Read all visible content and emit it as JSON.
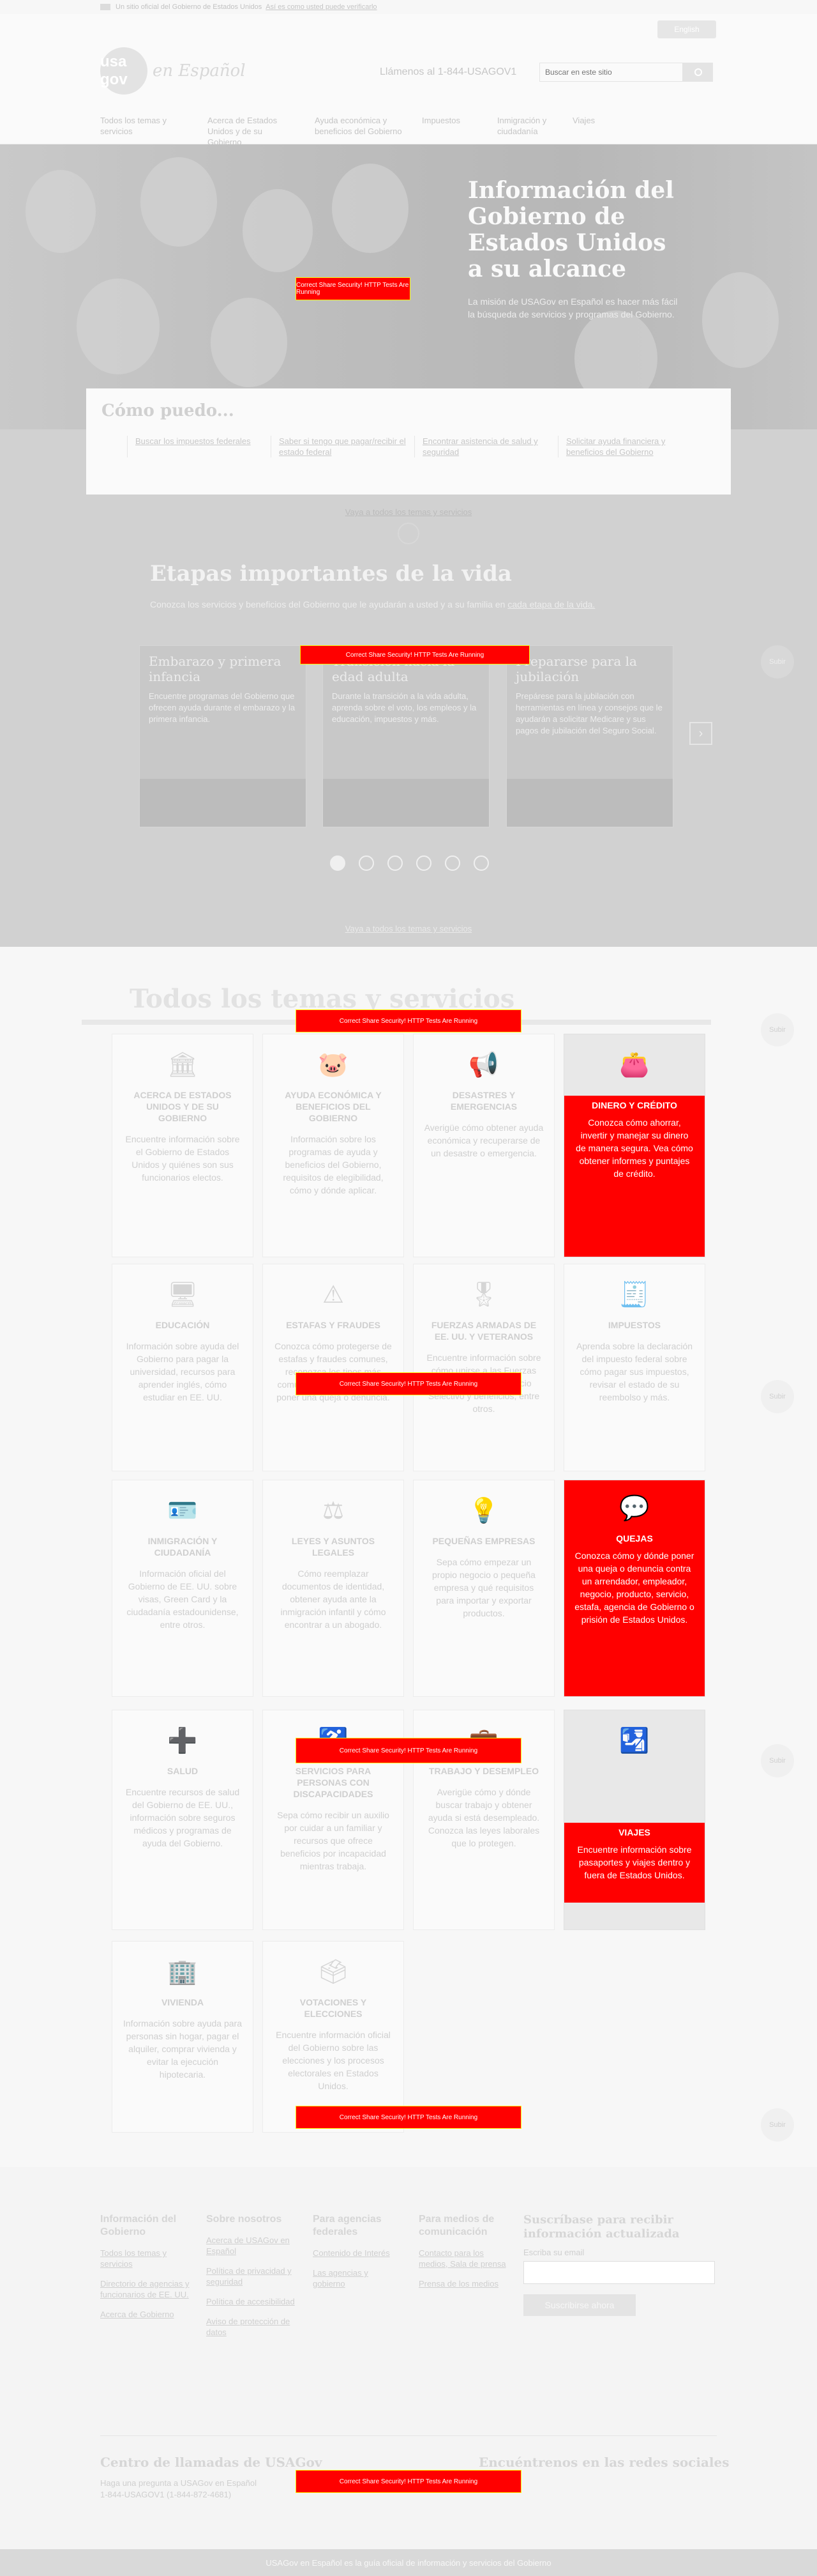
{
  "banner": {
    "text": "Un sitio oficial del Gobierno de Estados Unidos",
    "link": "Así es como usted puede verificarlo"
  },
  "header": {
    "lang_button": "English",
    "logo_mark": "usa gov",
    "logo_tagline": "en Español",
    "phone": "Llámenos al 1-844-USAGOV1",
    "search_placeholder": "Buscar en este sitio"
  },
  "nav": [
    "Todos los temas y servicios",
    "Acerca de Estados Unidos y de su Gobierno",
    "Ayuda económica y beneficios del Gobierno",
    "Impuestos",
    "Inmigración y ciudadanía",
    "Viajes"
  ],
  "hero": {
    "title": "Información del Gobierno de Estados Unidos a su alcance",
    "subtitle": "La misión de USAGov en Español es hacer más fácil la búsqueda de servicios y programas del Gobierno."
  },
  "how": {
    "title": "Cómo puedo...",
    "links": [
      "Buscar los impuestos federales",
      "Saber si tengo que pagar/recibir el estado federal",
      "Encontrar asistencia de salud y seguridad",
      "Solicitar ayuda financiera y beneficios del Gobierno"
    ],
    "more": "Vaya a todos los temas y servicios"
  },
  "stages": {
    "title": "Etapas importantes de la vida",
    "subtitle": "Conozca los servicios y beneficios del Gobierno que le ayudarán a usted y a su familia en",
    "subtitle_link": "cada etapa de la vida.",
    "cards": [
      {
        "title": "Embarazo y primera infancia",
        "desc": "Encuentre programas del Gobierno que ofrecen ayuda durante el embarazo y la primera infancia."
      },
      {
        "title": "Transición hacia la edad adulta",
        "desc": "Durante la transición a la vida adulta, aprenda sobre el voto, los empleos y la educación, impuestos y más."
      },
      {
        "title": "Prepararse para la jubilación",
        "desc": "Prepárese para la jubilación con herramientas en línea y consejos que le ayudarán a solicitar Medicare y sus pagos de jubilación del Seguro Social."
      }
    ],
    "next_arrow": "›",
    "more": "Vaya a todos los temas y servicios"
  },
  "topics": {
    "title": "Todos los temas y servicios",
    "tiles": [
      {
        "icon": "capitol-icon",
        "glyph": "🏛",
        "title": "Acerca de Estados Unidos y de su Gobierno",
        "desc": "Encuentre información sobre el Gobierno de Estados Unidos y quiénes son sus funcionarios electos."
      },
      {
        "icon": "piggy-bank-icon",
        "glyph": "🐷",
        "title": "Ayuda económica y beneficios del Gobierno",
        "desc": "Información sobre los programas de ayuda y beneficios del Gobierno, requisitos de elegibilidad, cómo y dónde aplicar."
      },
      {
        "icon": "megaphone-icon",
        "glyph": "📢",
        "title": "Desastres y emergencias",
        "desc": "Averigüe cómo obtener ayuda económica y recuperarse de un desastre o emergencia."
      },
      {
        "icon": "wallet-icon",
        "glyph": "👛",
        "title": "Dinero y crédito",
        "desc": "Conozca cómo ahorrar, invertir y manejar su dinero de manera segura. Vea cómo obtener informes y puntajes de crédito."
      },
      {
        "icon": "monitor-icon",
        "glyph": "🖥",
        "title": "Educación",
        "desc": "Información sobre ayuda del Gobierno para pagar la universidad, recursos para aprender inglés, cómo estudiar en EE. UU."
      },
      {
        "icon": "warning-icon",
        "glyph": "⚠",
        "title": "Estafas y fraudes",
        "desc": "Conozca cómo protegerse de estafas y fraudes comunes, reconozca los tipos más comunes y dónde reportar o poner una queja o denuncia."
      },
      {
        "icon": "medal-icon",
        "glyph": "🎖",
        "title": "Fuerzas Armadas de EE. UU. y veteranos",
        "desc": "Encuentre información sobre cómo unirse a las Fuerzas Armadas, cómo servicio Selectivo y beneficios, entre otros."
      },
      {
        "icon": "tax-form-icon",
        "glyph": "🧾",
        "title": "Impuestos",
        "desc": "Aprenda sobre la declaración del impuesto federal sobre cómo pagar sus impuestos, revisar el estado de su reembolso y más."
      },
      {
        "icon": "id-card-icon",
        "glyph": "🪪",
        "title": "Inmigración y ciudadanía",
        "desc": "Información oficial del Gobierno de EE. UU. sobre visas, Green Card y la ciudadanía estadounidense, entre otros."
      },
      {
        "icon": "scales-icon",
        "glyph": "⚖",
        "title": "Leyes y asuntos legales",
        "desc": "Cómo reemplazar documentos de identidad, obtener ayuda ante la inmigración infantil y cómo encontrar a un abogado."
      },
      {
        "icon": "lightbulb-icon",
        "glyph": "💡",
        "title": "Pequeñas empresas",
        "desc": "Sepa cómo empezar un propio negocio o pequeña empresa y qué requisitos para importar y exportar productos."
      },
      {
        "icon": "chat-bubbles-icon",
        "glyph": "💬",
        "title": "Quejas",
        "desc": "Conozca cómo y dónde poner una queja o denuncia contra un arrendador, empleador, negocio, producto, servicio, estafa, agencia de Gobierno o prisión de Estados Unidos."
      },
      {
        "icon": "health-icon",
        "glyph": "➕",
        "title": "Salud",
        "desc": "Encuentre recursos de salud del Gobierno de EE. UU., información sobre seguros médicos y programas de ayuda del Gobierno."
      },
      {
        "icon": "accessibility-icon",
        "glyph": "♿",
        "title": "Servicios para personas con discapacidades",
        "desc": "Sepa cómo recibir un auxilio por cuidar a un familiar y recursos que ofrece beneficios por incapacidad mientras trabaja."
      },
      {
        "icon": "briefcase-icon",
        "glyph": "💼",
        "title": "Trabajo y desempleo",
        "desc": "Averigüe cómo y dónde buscar trabajo y obtener ayuda si está desempleado. Conozca las leyes laborales que lo protegen."
      },
      {
        "icon": "passport-icon",
        "glyph": "🛂",
        "title": "Viajes",
        "desc": "Encuentre información sobre pasaportes y viajes dentro y fuera de Estados Unidos."
      },
      {
        "icon": "house-icon",
        "glyph": "🏢",
        "title": "Vivienda",
        "desc": "Información sobre ayuda para personas sin hogar, pagar el alquiler, comprar vivienda y evitar la ejecución hipotecaria."
      },
      {
        "icon": "ballot-icon",
        "glyph": "🗳",
        "title": "Votaciones y elecciones",
        "desc": "Encuentre información oficial del Gobierno sobre las elecciones y los procesos electorales en Estados Unidos."
      }
    ]
  },
  "side_buttons": {
    "label": "Subir"
  },
  "footer": {
    "columns": [
      {
        "title": "Información del Gobierno",
        "links": [
          "Todos los temas y servicios",
          "Directorio de agencias y funcionarios de EE. UU.",
          "Acerca de Gobierno"
        ]
      },
      {
        "title": "Sobre nosotros",
        "links": [
          "Acerca de USAGov en Español",
          "Política de privacidad y seguridad",
          "Política de accesibilidad",
          "Aviso de protección de datos"
        ]
      },
      {
        "title": "Para agencias federales",
        "links": [
          "Contenido de Interés",
          "Las agencias y gobierno"
        ]
      },
      {
        "title": "Para medios de comunicación",
        "links": [
          "Contacto para los medios, Sala de prensa",
          "Prensa de los medios"
        ]
      }
    ],
    "subscribe": {
      "title": "Suscríbase para recibir información actualizada",
      "label": "Escriba su email",
      "button": "Suscribirse ahora"
    },
    "call_title": "Centro de llamadas de USAGov",
    "call_desc": "Haga una pregunta a USAGov en Español 1-844-USAGOV1 (1-844-872-4681)",
    "social_title": "Encuéntrenos en las redes sociales",
    "bottom": "USAGov en Español es la guía oficial de información y servicios del Gobierno"
  },
  "notices": {
    "text": "Correct Share Security! HTTP Tests Are Running"
  }
}
